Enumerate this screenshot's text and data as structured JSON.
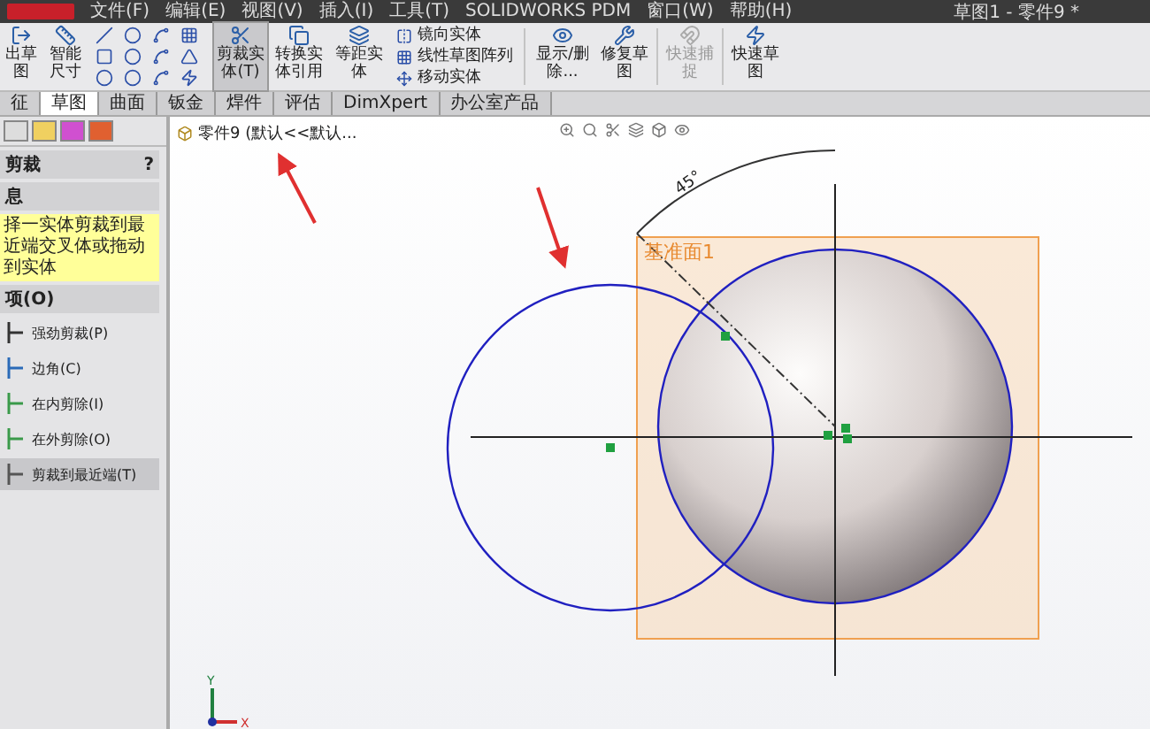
{
  "menu": {
    "items": [
      "文件(F)",
      "编辑(E)",
      "视图(V)",
      "插入(I)",
      "工具(T)",
      "SOLIDWORKS PDM",
      "窗口(W)",
      "帮助(H)"
    ],
    "title": "草图1 - 零件9 *"
  },
  "ribbon": {
    "large": [
      {
        "label": "出草图",
        "selected": false,
        "disabled": false
      },
      {
        "label": "智能尺寸",
        "selected": false,
        "disabled": false
      },
      {
        "label": "剪裁实体(T)",
        "selected": true,
        "disabled": false
      },
      {
        "label": "转换实体引用",
        "selected": false,
        "disabled": false
      },
      {
        "label": "等距实体",
        "selected": false,
        "disabled": false
      }
    ],
    "list": [
      "镜向实体",
      "线性草图阵列",
      "移动实体"
    ],
    "right": [
      {
        "label": "显示/删除...",
        "selected": false,
        "disabled": false
      },
      {
        "label": "修复草图",
        "selected": false,
        "disabled": false
      },
      {
        "label": "快速捕捉",
        "selected": false,
        "disabled": true
      },
      {
        "label": "快速草图",
        "selected": false,
        "disabled": false
      }
    ]
  },
  "tabs": [
    {
      "label": "征",
      "selected": false
    },
    {
      "label": "草图",
      "selected": true
    },
    {
      "label": "曲面",
      "selected": false
    },
    {
      "label": "钣金",
      "selected": false
    },
    {
      "label": "焊件",
      "selected": false
    },
    {
      "label": "评估",
      "selected": false
    },
    {
      "label": "DimXpert",
      "selected": false
    },
    {
      "label": "办公室产品",
      "selected": false
    }
  ],
  "panel": {
    "title": "剪裁",
    "help": "?",
    "message_title": "息",
    "message": "择一实体剪裁到最近端交叉体或拖动到实体",
    "options_title": "项(O)",
    "options": [
      {
        "label": "强劲剪裁(P)",
        "selected": false
      },
      {
        "label": "边角(C)",
        "selected": false
      },
      {
        "label": "在内剪除(I)",
        "selected": false
      },
      {
        "label": "在外剪除(O)",
        "selected": false
      },
      {
        "label": "剪裁到最近端(T)",
        "selected": true
      }
    ]
  },
  "tree": {
    "item": "零件9  (默认<<默认..."
  },
  "canvas": {
    "plane_label": "基准面1",
    "angle": "45°",
    "axis_x": "X",
    "axis_y": "Y"
  }
}
